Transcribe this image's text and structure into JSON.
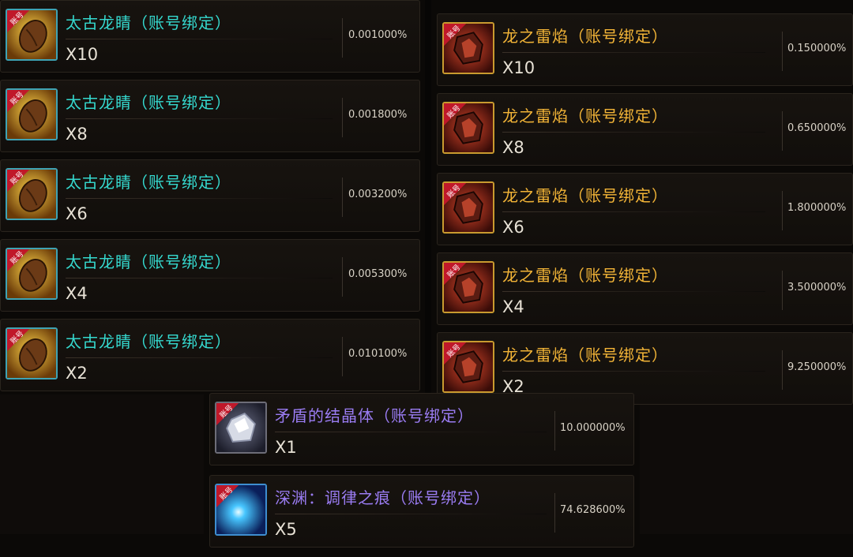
{
  "rows_left": [
    {
      "name": "太古龙睛（账号绑定）",
      "qty": "X10",
      "rate": "0.001000%",
      "badge": "账号"
    },
    {
      "name": "太古龙睛（账号绑定）",
      "qty": "X8",
      "rate": "0.001800%",
      "badge": "账号"
    },
    {
      "name": "太古龙睛（账号绑定）",
      "qty": "X6",
      "rate": "0.003200%",
      "badge": "账号"
    },
    {
      "name": "太古龙睛（账号绑定）",
      "qty": "X4",
      "rate": "0.005300%",
      "badge": "账号"
    },
    {
      "name": "太古龙睛（账号绑定）",
      "qty": "X2",
      "rate": "0.010100%",
      "badge": "账号"
    }
  ],
  "rows_right": [
    {
      "name": "龙之雷焰（账号绑定）",
      "qty": "X10",
      "rate": "0.150000%",
      "badge": "账号"
    },
    {
      "name": "龙之雷焰（账号绑定）",
      "qty": "X8",
      "rate": "0.650000%",
      "badge": "账号"
    },
    {
      "name": "龙之雷焰（账号绑定）",
      "qty": "X6",
      "rate": "1.800000%",
      "badge": "账号"
    },
    {
      "name": "龙之雷焰（账号绑定）",
      "qty": "X4",
      "rate": "3.500000%",
      "badge": "账号"
    },
    {
      "name": "龙之雷焰（账号绑定）",
      "qty": "X2",
      "rate": "9.250000%",
      "badge": "账号"
    }
  ],
  "rows_bottom": [
    {
      "name": "矛盾的结晶体（账号绑定）",
      "qty": "X1",
      "rate": "10.000000%",
      "badge": "账号"
    },
    {
      "name": "深渊：调律之痕（账号绑定）",
      "qty": "X5",
      "rate": "74.628600%",
      "badge": "账号"
    }
  ],
  "icons": {
    "left": "dragon-eye-icon",
    "right": "dragon-thunder-flame-icon",
    "bottom_0": "crystal-icon",
    "bottom_1": "abyss-orb-icon"
  },
  "colors": {
    "name_teal": "#35d9cf",
    "name_gold": "#f2b437",
    "name_purple": "#9a7cf2",
    "badge_red": "#c0182a"
  }
}
